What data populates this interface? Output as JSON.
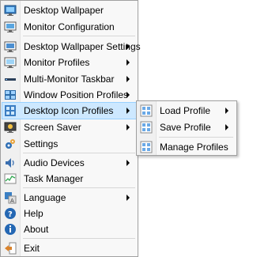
{
  "menu": {
    "items": [
      {
        "label": "Desktop Wallpaper",
        "icon": "desktop-wallpaper-icon"
      },
      {
        "label": "Monitor Configuration",
        "icon": "monitor-configuration-icon"
      },
      {
        "label": "Desktop Wallpaper Settings",
        "icon": "wallpaper-settings-icon",
        "submenu": true
      },
      {
        "label": "Monitor Profiles",
        "icon": "monitor-icon",
        "submenu": true
      },
      {
        "label": "Multi-Monitor Taskbar",
        "icon": "taskbar-icon",
        "submenu": true
      },
      {
        "label": "Window Position Profiles",
        "icon": "window-grid-icon",
        "submenu": true
      },
      {
        "label": "Desktop Icon Profiles",
        "icon": "desktop-icons-icon",
        "submenu": true,
        "highlighted": true
      },
      {
        "label": "Screen Saver",
        "icon": "screen-saver-icon",
        "submenu": true
      },
      {
        "label": "Settings",
        "icon": "settings-gears-icon"
      },
      {
        "label": "Audio Devices",
        "icon": "speaker-icon",
        "submenu": true
      },
      {
        "label": "Task Manager",
        "icon": "task-manager-icon"
      },
      {
        "label": "Language",
        "icon": "language-icon",
        "submenu": true
      },
      {
        "label": "Help",
        "icon": "help-icon"
      },
      {
        "label": "About",
        "icon": "info-icon"
      },
      {
        "label": "Exit",
        "icon": "exit-icon"
      }
    ]
  },
  "submenu": {
    "items": [
      {
        "label": "Load Profile",
        "icon": "load-profile-icon",
        "submenu": true
      },
      {
        "label": "Save Profile",
        "icon": "save-profile-icon",
        "submenu": true
      },
      {
        "label": "Manage Profiles",
        "icon": "manage-profiles-icon"
      }
    ]
  },
  "colors": {
    "highlight_bg": "#cde8ff",
    "highlight_border": "#99d1ff",
    "menu_bg": "#f8f8f8",
    "menu_border": "#a0a0a0"
  }
}
